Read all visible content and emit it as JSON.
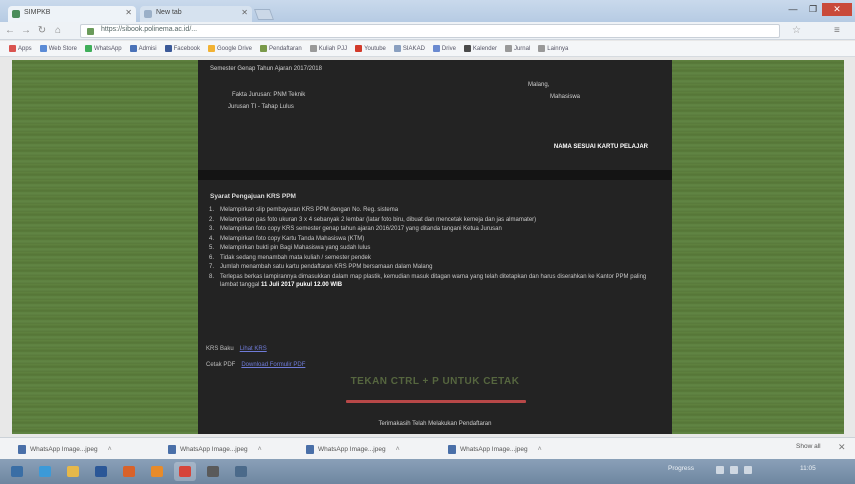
{
  "browser": {
    "tabs": [
      {
        "label": "SIMPKB",
        "active": true
      },
      {
        "label": "New tab",
        "active": false
      }
    ],
    "window_controls": {
      "minimize": "—",
      "maximize": "❐",
      "close": "✕"
    },
    "nav": {
      "back": "←",
      "forward": "→",
      "reload": "↻",
      "home": "⌂"
    },
    "url": "https://sibook.polinema.ac.id/...",
    "star": "☆",
    "menu": "≡",
    "bookmarks": [
      {
        "label": "Apps",
        "color": "#d9534f"
      },
      {
        "label": "Web Store",
        "color": "#5b8bd6"
      },
      {
        "label": "WhatsApp",
        "color": "#3fae5a"
      },
      {
        "label": "Admisi",
        "color": "#4a72b8"
      },
      {
        "label": "Facebook",
        "color": "#3b5998"
      },
      {
        "label": "Google Drive",
        "color": "#f2b233"
      },
      {
        "label": "Pendaftaran",
        "color": "#7a9a4a"
      },
      {
        "label": "Kuliah PJJ",
        "color": "#999999"
      },
      {
        "label": "Youtube",
        "color": "#d23a2a"
      },
      {
        "label": "SIAKAD",
        "color": "#8aa0c0"
      },
      {
        "label": "Drive",
        "color": "#6a8ad0"
      },
      {
        "label": "Kalender",
        "color": "#4a4a4a"
      },
      {
        "label": "Jurnal",
        "color": "#999999"
      },
      {
        "label": "Lainnya",
        "color": "#999999"
      }
    ]
  },
  "page": {
    "receipt": {
      "header_line": "Semester Genap Tahun Ajaran 2017/2018",
      "faculty_line": "Fakta Jurusan: PNM Teknik",
      "status_line": "Jurusan TI - Tahap Lulus",
      "location_line": "Malang,",
      "signer_label": "Mahasiswa",
      "sign_name": "NAMA SESUAI KARTU PELAJAR"
    },
    "requirements_title": "Syarat Pengajuan KRS PPM",
    "requirements": [
      {
        "num": "1.",
        "text": "Melampirkan slip pembayaran KRS PPM dengan No. Reg. sistema"
      },
      {
        "num": "2.",
        "text": "Melampirkan pas foto ukuran 3 x 4 sebanyak 2 lembar (latar foto biru, dibuat dan mencetak kemeja dan jas almamater)"
      },
      {
        "num": "3.",
        "text": "Melampirkan foto copy KRS semester genap tahun ajaran 2016/2017 yang ditanda tangani Ketua Jurusan"
      },
      {
        "num": "4.",
        "text": "Melampirkan foto copy Kartu Tanda Mahasiswa (KTM)"
      },
      {
        "num": "5.",
        "text": "Melampirkan bukti pin Bagi Mahasiswa yang sudah lulus"
      },
      {
        "num": "6.",
        "text": "Tidak sedang menambah mata kuliah / semester pendek"
      },
      {
        "num": "7.",
        "text": "Jumlah menambah satu kartu pendaftaran KRS PPM bersamaan dalam Malang"
      },
      {
        "num": "8.",
        "text": "Terlepas berkas lampirannya dimasukkan dalam map plastik, kemudian masuk ditagan warna yang telah ditetapkan dan harus diserahkan ke Kantor PPM paling lambat tanggal",
        "deadline": "11 Juli 2017 pukul 12.00 WIB"
      }
    ],
    "fields": [
      {
        "label": "KRS Baku",
        "value": "Lihat KRS"
      },
      {
        "label": "Cetak PDF",
        "value": "Download Formulir PDF"
      }
    ],
    "print_hint": "TEKAN CTRL + P UNTUK CETAK",
    "thanks": "Terimakasih Telah Melakukan Pendaftaran"
  },
  "downloads": {
    "items": [
      {
        "label": "WhatsApp Image...jpeg"
      },
      {
        "label": "WhatsApp Image...jpeg"
      },
      {
        "label": "WhatsApp Image...jpeg"
      },
      {
        "label": "WhatsApp Image...jpeg"
      }
    ],
    "show_all": "Show all",
    "close": "✕"
  },
  "taskbar": {
    "apps": [
      {
        "name": "start",
        "color": "#3a6ea5"
      },
      {
        "name": "ie",
        "color": "#3c9ad8"
      },
      {
        "name": "explorer",
        "color": "#e6b84a"
      },
      {
        "name": "word",
        "color": "#2b5797"
      },
      {
        "name": "firefox",
        "color": "#d8622a"
      },
      {
        "name": "media",
        "color": "#e88b2a"
      },
      {
        "name": "chrome",
        "color": "#d6453a"
      },
      {
        "name": "app7",
        "color": "#5a5a5a"
      },
      {
        "name": "app8",
        "color": "#4b6a8a"
      }
    ],
    "tray_label": "Progress",
    "clock": "11:05"
  },
  "colors": {
    "background_green": "#5b7b3b",
    "panel_dark": "#232323",
    "accent_red": "#b84848"
  }
}
